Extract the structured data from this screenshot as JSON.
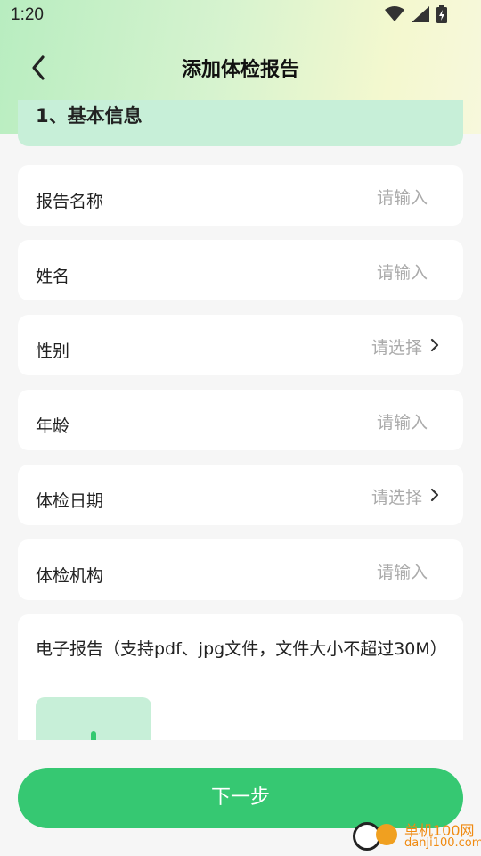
{
  "status_bar": {
    "time": "1:20"
  },
  "header": {
    "title": "添加体检报告"
  },
  "section": {
    "title": "1、基本信息"
  },
  "fields": [
    {
      "label": "报告名称",
      "placeholder": "请输入",
      "type": "input"
    },
    {
      "label": "姓名",
      "placeholder": "请输入",
      "type": "input"
    },
    {
      "label": "性别",
      "placeholder": "请选择",
      "type": "select"
    },
    {
      "label": "年龄",
      "placeholder": "请输入",
      "type": "input"
    },
    {
      "label": "体检日期",
      "placeholder": "请选择",
      "type": "select"
    },
    {
      "label": "体检机构",
      "placeholder": "请输入",
      "type": "input"
    }
  ],
  "upload": {
    "label": "电子报告（支持pdf、jpg文件，文件大小不超过30M）"
  },
  "footer": {
    "next_label": "下一步"
  },
  "watermark": {
    "name": "单机100网",
    "domain": "danji100.com"
  },
  "colors": {
    "accent": "#36c872",
    "section_bg": "#c7efd8",
    "placeholder": "#aaaaaa"
  },
  "icons": {
    "back": "chevron-left-icon",
    "select": "chevron-right-icon",
    "wifi": "wifi-icon",
    "signal": "signal-icon",
    "battery": "battery-icon"
  }
}
